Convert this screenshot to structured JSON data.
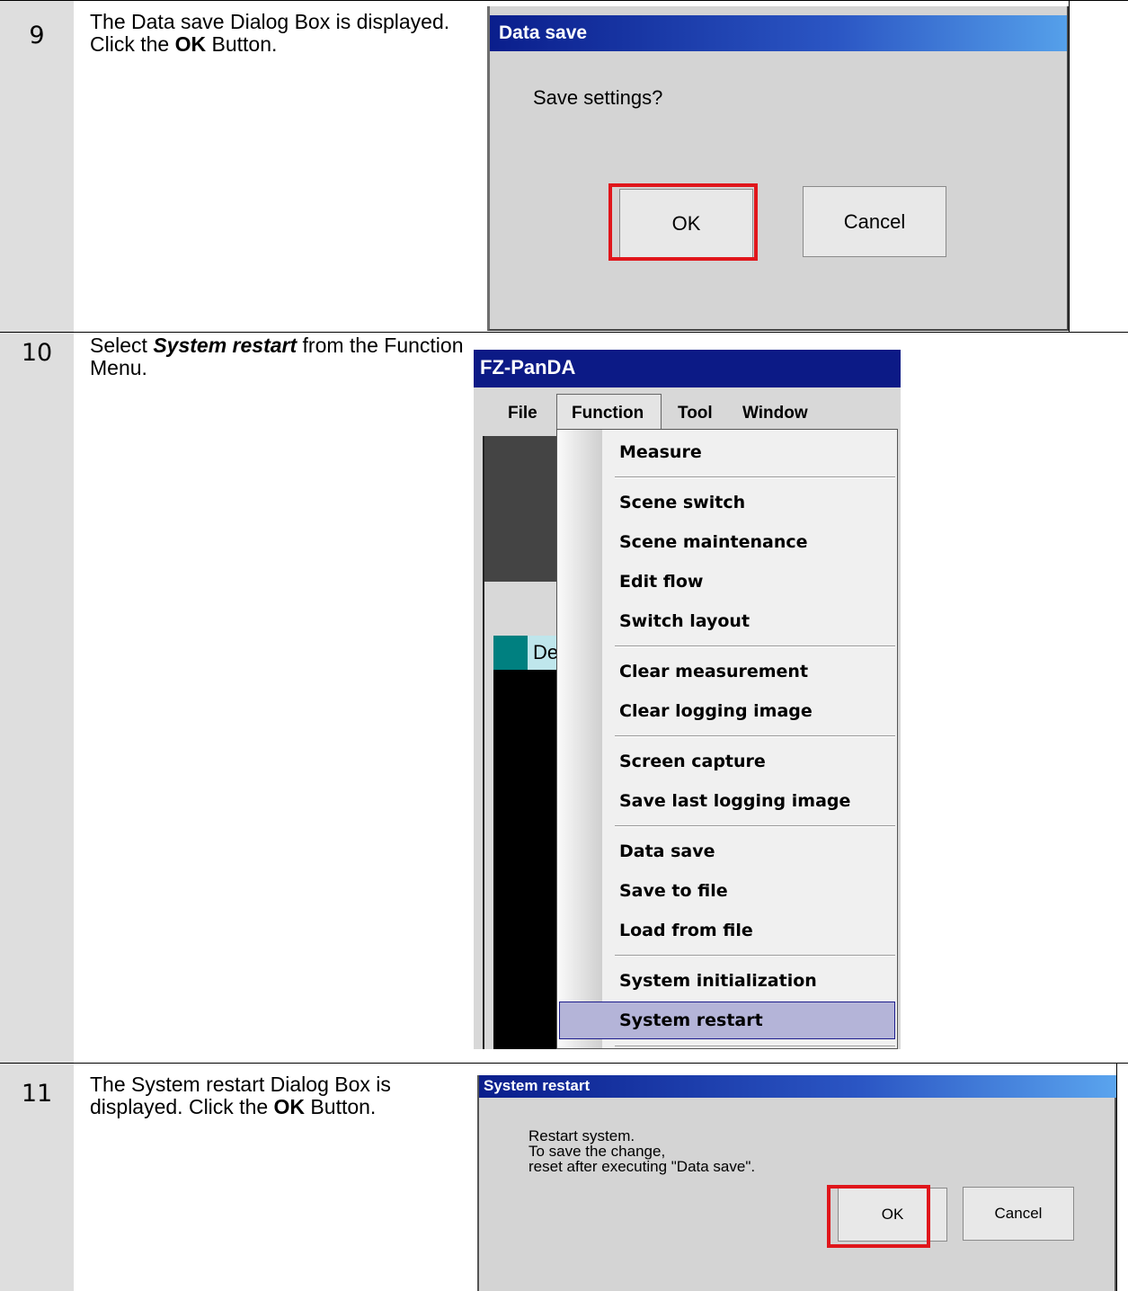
{
  "steps": [
    {
      "number": "9",
      "text_pre": "The Data save Dialog Box is displayed. Click the ",
      "text_bold": "OK",
      "text_post": " Button.",
      "dialog": {
        "title": "Data save",
        "message": "Save settings?",
        "ok_label": "OK",
        "cancel_label": "Cancel"
      }
    },
    {
      "number": "10",
      "text_pre": "Select ",
      "text_bold": "System restart",
      "text_post": " from the Function Menu.",
      "app": {
        "title": "FZ-PanDA",
        "menubar": [
          "File",
          "Function",
          "Tool",
          "Window"
        ],
        "partial_label": "De",
        "menu_items": [
          "Measure",
          "Scene switch",
          "Scene maintenance",
          "Edit flow",
          "Switch layout",
          "Clear measurement",
          "Clear logging image",
          "Screen capture",
          "Save last logging image",
          "Data save",
          "Save to file",
          "Load from file",
          "System initialization",
          "System restart"
        ],
        "selected_item": "System restart"
      }
    },
    {
      "number": "11",
      "text_pre": "The System restart Dialog Box is displayed. Click the ",
      "text_bold": "OK",
      "text_post": " Button.",
      "dialog": {
        "title": "System restart",
        "message": "Restart system.\nTo save the change,\nreset after executing \"Data save\".",
        "ok_label": "OK",
        "cancel_label": "Cancel"
      }
    }
  ],
  "colors": {
    "highlight": "#e0161b",
    "titlebar": "#0c1a86",
    "number_column": "#dedede"
  }
}
